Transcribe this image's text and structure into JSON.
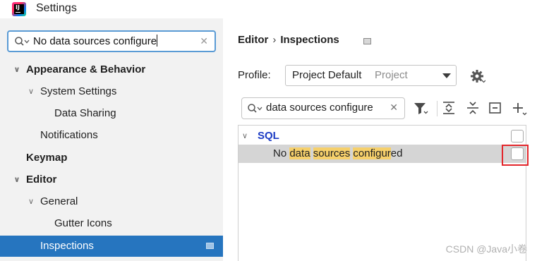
{
  "window": {
    "title": "Settings",
    "logo_text": "IJ"
  },
  "sidebar": {
    "search": {
      "value": "No data sources configure"
    },
    "items": [
      {
        "label": "Appearance & Behavior",
        "expanded": true
      },
      {
        "label": "System Settings",
        "expanded": true
      },
      {
        "label": "Data Sharing"
      },
      {
        "label": "Notifications"
      },
      {
        "label": "Keymap"
      },
      {
        "label": "Editor",
        "expanded": true
      },
      {
        "label": "General",
        "expanded": true
      },
      {
        "label": "Gutter Icons"
      },
      {
        "label": "Inspections",
        "selected": true
      }
    ]
  },
  "main": {
    "breadcrumb": {
      "parent": "Editor",
      "separator": "›",
      "current": "Inspections"
    },
    "profile": {
      "label": "Profile:",
      "value": "Project Default",
      "scope": "Project"
    },
    "filter": {
      "value": "data sources configure"
    },
    "tree": {
      "group": {
        "label": "SQL",
        "checked": false
      },
      "inspection": {
        "parts": [
          "No ",
          "data",
          " ",
          "sources",
          " ",
          "configur",
          "ed"
        ],
        "checked": false
      }
    }
  },
  "watermark": "CSDN @Java小卷",
  "colors": {
    "selection": "#2675bf",
    "highlight": "#f6d06b",
    "group_text": "#1b3bc4",
    "annotation": "#e3262b"
  },
  "icons": [
    "search-icon",
    "clear-icon",
    "chevron-down-icon",
    "chevron-right-icon",
    "settings-gear-icon",
    "filter-icon",
    "expand-all-icon",
    "collapse-all-icon",
    "reset-icon",
    "add-icon",
    "checkbox-icon"
  ]
}
